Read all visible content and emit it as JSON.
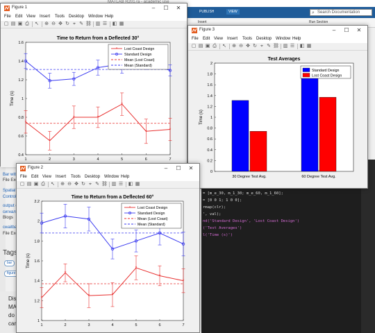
{
  "background": {
    "title": "MATLAB R2017a - academic use",
    "ribbon_tabs": [
      "PUBLISH",
      "VIEW"
    ],
    "search_placeholder": "Search Documentation",
    "insert_label": "Insert",
    "run_section_label": "Run Section",
    "sidebar_items": [
      {
        "text": "Bar with",
        "link": true
      },
      {
        "text": "File Exc",
        "link": false
      },
      {
        "text": "Spatial",
        "link": true
      },
      {
        "text": "Controll",
        "link": true
      },
      {
        "text": "output c",
        "link": true
      },
      {
        "text": "сигналов",
        "link": true
      },
      {
        "text": "Blogs",
        "link": false
      },
      {
        "text": "cwaitba",
        "link": true
      },
      {
        "text": "File Exc",
        "link": false
      }
    ],
    "tags_heading": "Tags",
    "tags": [
      "bar",
      "figure"
    ],
    "discuss_lines": [
      "Disc",
      "MA",
      "do",
      "caree"
    ],
    "code_lines": [
      {
        "text": "= [m_e_30, m_1_30; m_e_60, m_1_60];",
        "color": "light"
      },
      {
        "text": "= [0 0 1; 1 0 0];",
        "color": "light"
      },
      {
        "text": "rmap(clr);",
        "color": "light"
      },
      {
        "text": "', val);",
        "color": "light"
      },
      {
        "text": "nd('Standard Design', 'Lost Coast Design')",
        "color": "magenta"
      },
      {
        "text": "('Test Averages')",
        "color": "magenta"
      },
      {
        "text": "l('Time (s)')",
        "color": "magenta"
      }
    ]
  },
  "menus": [
    "File",
    "Edit",
    "View",
    "Insert",
    "Tools",
    "Desktop",
    "Window",
    "Help"
  ],
  "windows": {
    "figure1": {
      "title": "Figure 1"
    },
    "figure2": {
      "title": "Figure 2"
    },
    "figure3": {
      "title": "Figure 3"
    }
  },
  "colors": {
    "lost_coast": "#e8302f",
    "standard": "#3a3af0",
    "bar_standard": "#0000ff",
    "bar_lost": "#ff0000"
  },
  "chart_data": [
    {
      "id": "figure1",
      "type": "line",
      "title": "Time to Return from a Deflected 30°",
      "xlabel": "",
      "ylabel": "Time (s)",
      "x": [
        1,
        2,
        3,
        4,
        5,
        6,
        7
      ],
      "xlim": [
        1,
        7
      ],
      "ylim": [
        0.4,
        1.6
      ],
      "xticks": [
        1,
        2,
        3,
        4,
        5,
        6,
        7
      ],
      "yticks": [
        0.4,
        0.6,
        0.8,
        1,
        1.2,
        1.4,
        1.6
      ],
      "legend_position": "top-right",
      "grid": false,
      "series": [
        {
          "name": "Lost Coast Design",
          "values": [
            0.75,
            0.55,
            0.8,
            0.8,
            0.94,
            0.65,
            0.67
          ],
          "errors": [
            0.12,
            0.1,
            0.12,
            0.11,
            0.12,
            0.13,
            0.12
          ],
          "color": "#e8302f",
          "marker": "star"
        },
        {
          "name": "Standard Design",
          "values": [
            1.4,
            1.19,
            1.21,
            1.33,
            1.37,
            1.38,
            1.3
          ],
          "errors": [
            0.08,
            0.08,
            0.07,
            0.08,
            0.1,
            0.07,
            0.06
          ],
          "color": "#3a3af0",
          "marker": "circle"
        },
        {
          "name": "Mean (Lost Coast)",
          "constant": 0.735,
          "color": "#e8302f",
          "style": "dashed"
        },
        {
          "name": "Mean (Standard)",
          "constant": 1.31,
          "color": "#3a3af0",
          "style": "dashed"
        }
      ]
    },
    {
      "id": "figure3",
      "type": "bar",
      "title": "Test Averages",
      "xlabel": "",
      "ylabel": "Time (s)",
      "categories": [
        "30 Degree Test Avg.",
        "60 Degree Test Avg."
      ],
      "ylim": [
        0,
        2
      ],
      "yticks": [
        0,
        0.2,
        0.4,
        0.6,
        0.8,
        1,
        1.2,
        1.4,
        1.6,
        1.8,
        2
      ],
      "legend_position": "top-right",
      "grid": false,
      "series": [
        {
          "name": "Standard Design",
          "values": [
            1.31,
            1.88
          ],
          "color": "#0000ff"
        },
        {
          "name": "Lost Coast Design",
          "values": [
            0.74,
            1.37
          ],
          "color": "#ff0000"
        }
      ]
    },
    {
      "id": "figure2",
      "type": "line",
      "title": "Time to Return from a Deflected 60°",
      "xlabel": "",
      "ylabel": "Time (s)",
      "x": [
        1,
        2,
        3,
        4,
        5,
        6,
        7
      ],
      "xlim": [
        1,
        7
      ],
      "ylim": [
        1.0,
        2.2
      ],
      "xticks": [
        1,
        2,
        3,
        4,
        5,
        6,
        7
      ],
      "yticks": [
        1,
        1.2,
        1.4,
        1.6,
        1.8,
        2,
        2.2
      ],
      "legend_position": "top-right",
      "grid": false,
      "series": [
        {
          "name": "Lost Coast Design",
          "values": [
            1.23,
            1.48,
            1.25,
            1.26,
            1.53,
            1.45,
            1.4
          ],
          "errors": [
            0.1,
            0.09,
            0.12,
            0.12,
            0.12,
            0.1,
            0.12
          ],
          "color": "#e8302f",
          "marker": "star"
        },
        {
          "name": "Standard Design",
          "values": [
            1.98,
            2.05,
            2.02,
            1.72,
            1.8,
            1.88,
            1.77
          ],
          "errors": [
            0.1,
            0.12,
            0.12,
            0.1,
            0.11,
            0.12,
            0.12
          ],
          "color": "#3a3af0",
          "marker": "circle"
        },
        {
          "name": "Mean (Lost Coast)",
          "constant": 1.37,
          "color": "#e8302f",
          "style": "dashed"
        },
        {
          "name": "Mean (Standard)",
          "constant": 1.88,
          "color": "#3a3af0",
          "style": "dashed"
        }
      ]
    }
  ]
}
